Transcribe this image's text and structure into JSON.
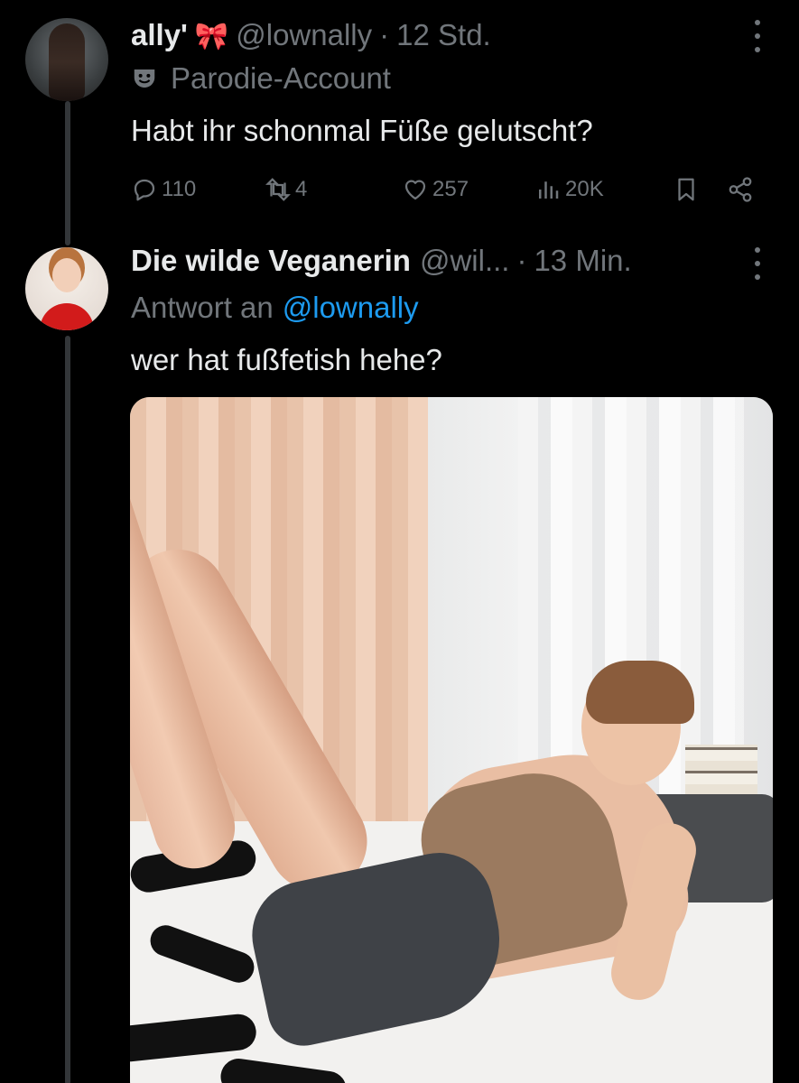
{
  "tweets": [
    {
      "display_name": "ally'",
      "name_emoji": "🎀",
      "handle": "@lownally",
      "separator": "·",
      "time": "12 Std.",
      "label": "Parodie-Account",
      "text": "Habt ihr schonmal Füße gelutscht?",
      "stats": {
        "replies": "110",
        "retweets": "4",
        "likes": "257",
        "views": "20K"
      }
    },
    {
      "display_name": "Die wilde Veganerin",
      "handle": "@wil...",
      "separator": "·",
      "time": "13 Min.",
      "reply_prefix": "Antwort an",
      "reply_to": "@lownally",
      "text": "wer hat fußfetish hehe?",
      "media": {
        "icon": "photo"
      }
    }
  ],
  "colors": {
    "background": "#000000",
    "text_primary": "#e7e9ea",
    "text_secondary": "#71767b",
    "link": "#1d9bf0",
    "thread_line": "#333639"
  }
}
